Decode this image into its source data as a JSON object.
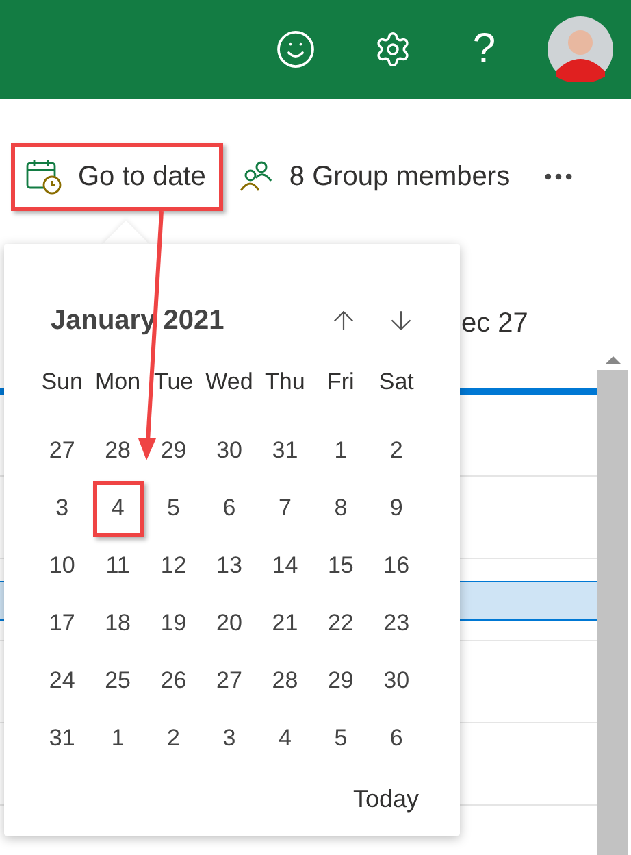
{
  "header": {
    "help": "?"
  },
  "toolbar": {
    "go_to_date": {
      "label": "Go to date",
      "highlighted": true
    },
    "group_members": "8 Group members"
  },
  "calendar_view": {
    "column_header": "ec 27"
  },
  "date_picker": {
    "title": "January 2021",
    "weekdays": [
      "Sun",
      "Mon",
      "Tue",
      "Wed",
      "Thu",
      "Fri",
      "Sat"
    ],
    "weeks": [
      [
        {
          "day": "27",
          "highlighted": false
        },
        {
          "day": "28",
          "highlighted": false
        },
        {
          "day": "29",
          "highlighted": false
        },
        {
          "day": "30",
          "highlighted": false
        },
        {
          "day": "31",
          "highlighted": false
        },
        {
          "day": "1",
          "highlighted": false
        },
        {
          "day": "2",
          "highlighted": false
        }
      ],
      [
        {
          "day": "3",
          "highlighted": false
        },
        {
          "day": "4",
          "highlighted": true
        },
        {
          "day": "5",
          "highlighted": false
        },
        {
          "day": "6",
          "highlighted": false
        },
        {
          "day": "7",
          "highlighted": false
        },
        {
          "day": "8",
          "highlighted": false
        },
        {
          "day": "9",
          "highlighted": false
        }
      ],
      [
        {
          "day": "10",
          "highlighted": false
        },
        {
          "day": "11",
          "highlighted": false
        },
        {
          "day": "12",
          "highlighted": false
        },
        {
          "day": "13",
          "highlighted": false
        },
        {
          "day": "14",
          "highlighted": false
        },
        {
          "day": "15",
          "highlighted": false
        },
        {
          "day": "16",
          "highlighted": false
        }
      ],
      [
        {
          "day": "17",
          "highlighted": false
        },
        {
          "day": "18",
          "highlighted": false
        },
        {
          "day": "19",
          "highlighted": false
        },
        {
          "day": "20",
          "highlighted": false
        },
        {
          "day": "21",
          "highlighted": false
        },
        {
          "day": "22",
          "highlighted": false
        },
        {
          "day": "23",
          "highlighted": false
        }
      ],
      [
        {
          "day": "24",
          "highlighted": false
        },
        {
          "day": "25",
          "highlighted": false
        },
        {
          "day": "26",
          "highlighted": false
        },
        {
          "day": "27",
          "highlighted": false
        },
        {
          "day": "28",
          "highlighted": false
        },
        {
          "day": "29",
          "highlighted": false
        },
        {
          "day": "30",
          "highlighted": false
        }
      ],
      [
        {
          "day": "31",
          "highlighted": false
        },
        {
          "day": "1",
          "highlighted": false
        },
        {
          "day": "2",
          "highlighted": false
        },
        {
          "day": "3",
          "highlighted": false
        },
        {
          "day": "4",
          "highlighted": false
        },
        {
          "day": "5",
          "highlighted": false
        },
        {
          "day": "6",
          "highlighted": false
        }
      ]
    ],
    "today_button": "Today"
  }
}
